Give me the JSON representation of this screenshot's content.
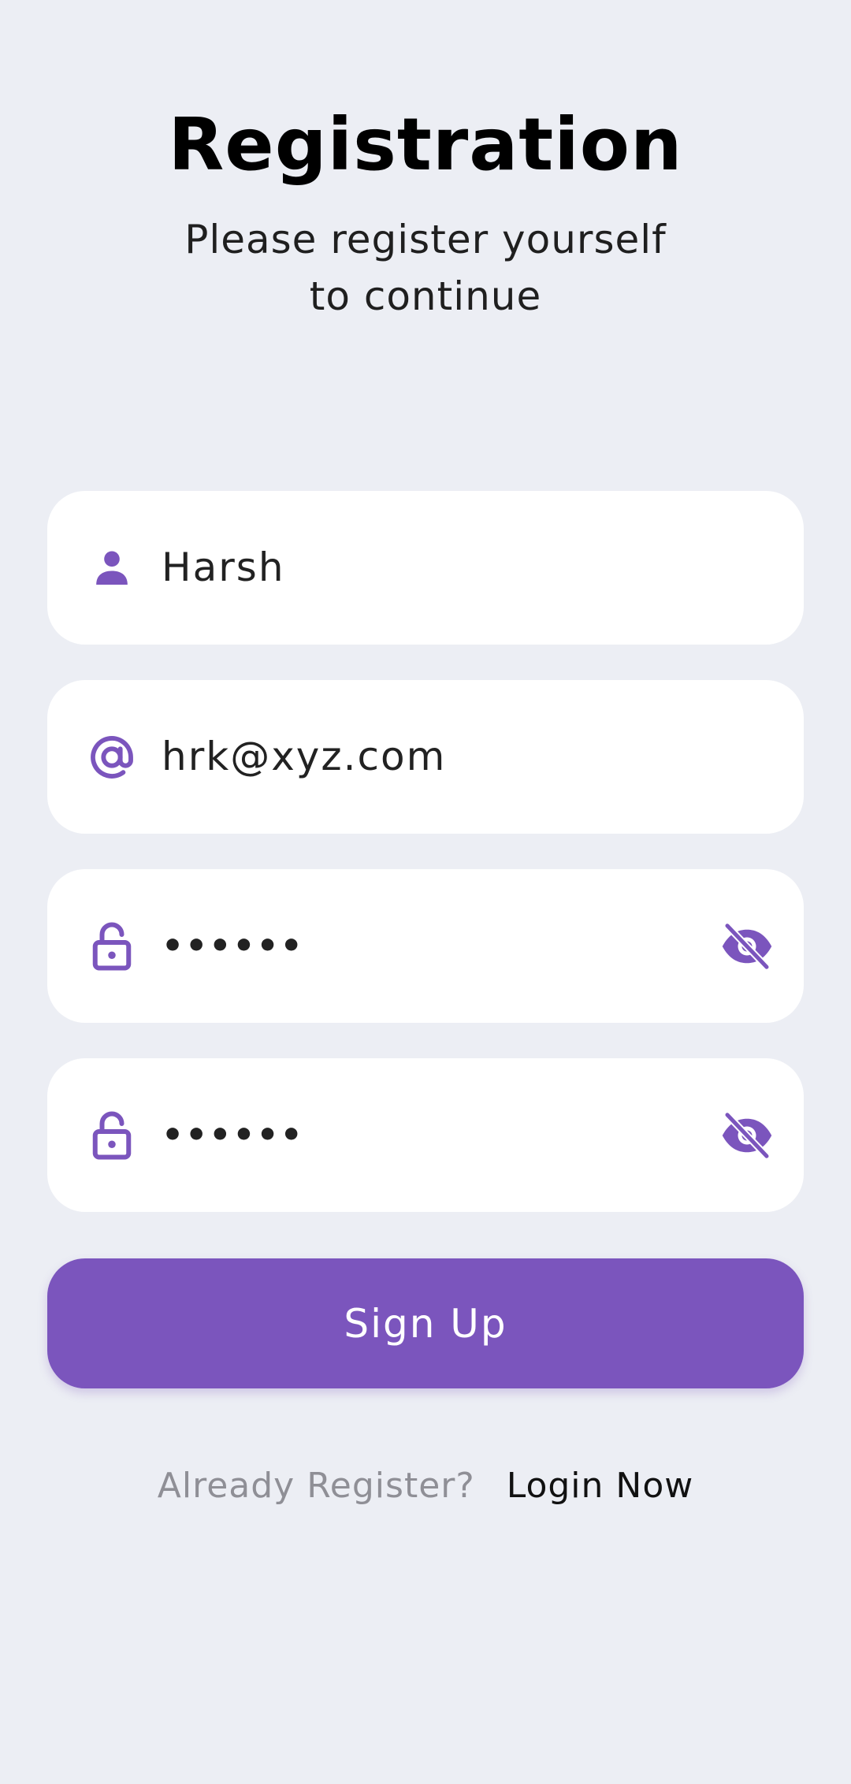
{
  "header": {
    "title": "Registration",
    "subtitle_line1": "Please register yourself",
    "subtitle_line2": "to continue"
  },
  "form": {
    "name": {
      "value": "Harsh",
      "icon": "person-icon"
    },
    "email": {
      "value": "hrk@xyz.com",
      "icon": "at-icon"
    },
    "password": {
      "value": "••••••",
      "icon": "lock-icon",
      "toggle_icon": "eye-off-icon"
    },
    "confirm_password": {
      "value": "••••••",
      "icon": "lock-icon",
      "toggle_icon": "eye-off-icon"
    }
  },
  "actions": {
    "signup_label": "Sign Up"
  },
  "footer": {
    "prompt": "Already Register?",
    "login_label": "Login Now"
  },
  "colors": {
    "accent": "#7b55bd",
    "background": "#eceef4",
    "field_background": "#ffffff",
    "muted_text": "#8f8f96"
  }
}
